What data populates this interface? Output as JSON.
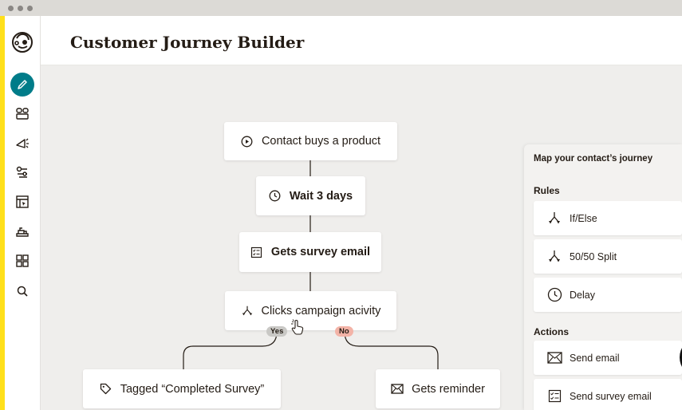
{
  "app": {
    "page_title": "Customer Journey Builder"
  },
  "sidebar": {
    "items": [
      {
        "name": "create",
        "icon": "pencil-icon",
        "active": true
      },
      {
        "name": "audience",
        "icon": "audience-icon"
      },
      {
        "name": "campaigns",
        "icon": "megaphone-icon"
      },
      {
        "name": "automations",
        "icon": "automation-icon"
      },
      {
        "name": "website",
        "icon": "website-icon"
      },
      {
        "name": "integrations",
        "icon": "integrations-icon"
      },
      {
        "name": "content",
        "icon": "grid-icon"
      },
      {
        "name": "search",
        "icon": "search-icon"
      }
    ]
  },
  "journey": {
    "trigger": {
      "label": "Contact buys a product",
      "icon": "play-circle-icon"
    },
    "wait": {
      "label": "Wait 3 days",
      "icon": "clock-icon"
    },
    "survey": {
      "label": "Gets survey email",
      "icon": "checklist-icon"
    },
    "condition": {
      "label": "Clicks campaign acivity",
      "icon": "split-icon"
    },
    "yes_label": "Yes",
    "no_label": "No",
    "tagged": {
      "label": "Tagged “Completed Survey”",
      "icon": "tag-icon"
    },
    "reminder": {
      "label": "Gets reminder",
      "icon": "envelope-icon"
    }
  },
  "panel": {
    "title": "Map your contact’s journey",
    "rules_heading": "Rules",
    "rules": [
      {
        "label": "If/Else",
        "icon": "split-icon"
      },
      {
        "label": "50/50 Split",
        "icon": "split-icon"
      },
      {
        "label": "Delay",
        "icon": "clock-icon"
      }
    ],
    "actions_heading": "Actions",
    "actions": [
      {
        "label": "Send email",
        "icon": "envelope-icon"
      },
      {
        "label": "Send survey email",
        "icon": "checklist-icon"
      }
    ]
  },
  "colors": {
    "accent_yellow": "#ffe01b",
    "active_teal": "#007c89",
    "no_badge": "#f3b3a7",
    "yes_badge": "#c9c8c5"
  }
}
